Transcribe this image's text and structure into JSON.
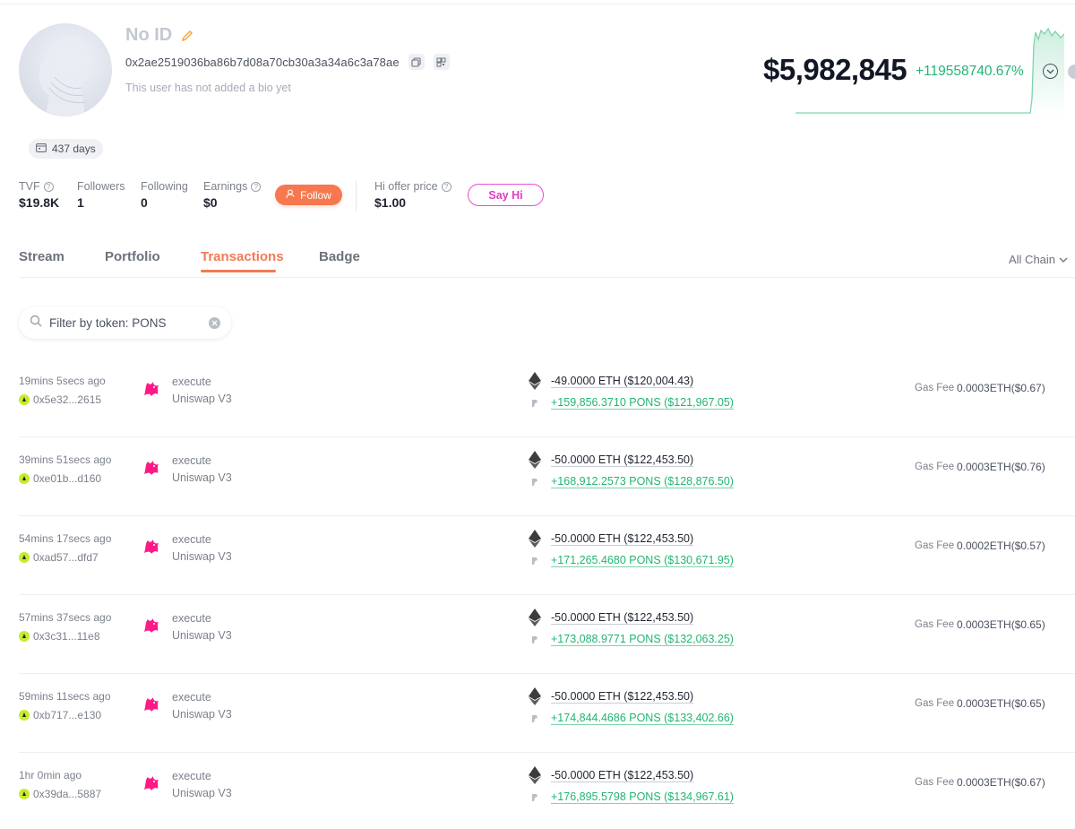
{
  "profile": {
    "name": "No ID",
    "address": "0x2ae2519036ba86b7d08a70cb30a3a34a6c3a78ae",
    "bio": "This user has not added a bio yet",
    "days": "437 days"
  },
  "stats": {
    "tvf_label": "TVF",
    "tvf_value": "$19.8K",
    "followers_label": "Followers",
    "followers_value": "1",
    "following_label": "Following",
    "following_value": "0",
    "earnings_label": "Earnings",
    "earnings_value": "$0",
    "follow_label": "Follow",
    "offer_label": "Hi offer price",
    "offer_value": "$1.00",
    "sayhi_label": "Say Hi"
  },
  "balance": {
    "value": "$5,982,845",
    "change": "+119558740.67%"
  },
  "tabs": [
    {
      "label": "Stream"
    },
    {
      "label": "Portfolio"
    },
    {
      "label": "Transactions",
      "active": true
    },
    {
      "label": "Badge"
    }
  ],
  "chain_filter": "All Chain",
  "search": {
    "value": "Filter by token: PONS"
  },
  "gas_label": "Gas Fee",
  "transactions": [
    {
      "time": "19mins 5secs ago",
      "hash": "0x5e32...2615",
      "method": "execute",
      "dex": "Uniswap V3",
      "out": "-49.0000 ETH ($120,004.43)",
      "in": "+159,856.3710 PONS ($121,967.05)",
      "gas": "0.0003ETH($0.67)"
    },
    {
      "time": "39mins 51secs ago",
      "hash": "0xe01b...d160",
      "method": "execute",
      "dex": "Uniswap V3",
      "out": "-50.0000 ETH ($122,453.50)",
      "in": "+168,912.2573 PONS ($128,876.50)",
      "gas": "0.0003ETH($0.76)"
    },
    {
      "time": "54mins 17secs ago",
      "hash": "0xad57...dfd7",
      "method": "execute",
      "dex": "Uniswap V3",
      "out": "-50.0000 ETH ($122,453.50)",
      "in": "+171,265.4680 PONS ($130,671.95)",
      "gas": "0.0002ETH($0.57)"
    },
    {
      "time": "57mins 37secs ago",
      "hash": "0x3c31...11e8",
      "method": "execute",
      "dex": "Uniswap V3",
      "out": "-50.0000 ETH ($122,453.50)",
      "in": "+173,088.9771 PONS ($132,063.25)",
      "gas": "0.0003ETH($0.65)"
    },
    {
      "time": "59mins 11secs ago",
      "hash": "0xb717...e130",
      "method": "execute",
      "dex": "Uniswap V3",
      "out": "-50.0000 ETH ($122,453.50)",
      "in": "+174,844.4686 PONS ($133,402.66)",
      "gas": "0.0003ETH($0.65)"
    },
    {
      "time": "1hr 0min ago",
      "hash": "0x39da...5887",
      "method": "execute",
      "dex": "Uniswap V3",
      "out": "-50.0000 ETH ($122,453.50)",
      "in": "+176,895.5798 PONS ($134,967.61)",
      "gas": "0.0003ETH($0.67)"
    }
  ],
  "colors": {
    "accent": "#f27a56",
    "positive": "#22b573",
    "sayhi": "#e03ac6",
    "lime": "#c6ec2a"
  },
  "icons": [
    "edit-icon",
    "copy-icon",
    "qr-icon",
    "calendar-icon",
    "info-icon",
    "user-plus-icon",
    "chevron-down-icon",
    "search-icon",
    "clear-icon",
    "uniswap-icon",
    "eth-icon",
    "pons-token-icon",
    "chain-icon"
  ]
}
